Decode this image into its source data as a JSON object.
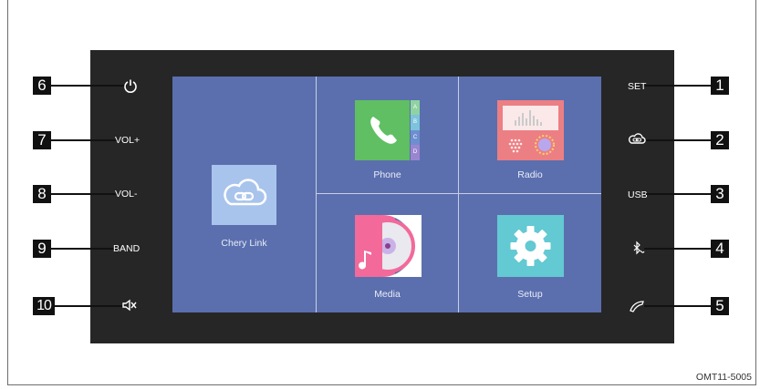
{
  "screen": {
    "tiles": {
      "link": {
        "label": "Chery Link",
        "icon": "chery-link-cloud-icon",
        "color": "#a9c4ec"
      },
      "phone": {
        "label": "Phone",
        "icon": "phone-handset-icon",
        "color": "#5fbf62",
        "index_tabs": [
          "A",
          "B",
          "C",
          "D"
        ]
      },
      "radio": {
        "label": "Radio",
        "icon": "radio-icon",
        "color": "#ec7f83"
      },
      "media": {
        "label": "Media",
        "icon": "media-disc-icon",
        "color": "#f2699a"
      },
      "setup": {
        "label": "Setup",
        "icon": "gear-icon",
        "color": "#63c9d3"
      }
    }
  },
  "left_buttons": [
    {
      "number": "6",
      "label": "",
      "icon": "power-icon"
    },
    {
      "number": "7",
      "label": "VOL+",
      "icon": ""
    },
    {
      "number": "8",
      "label": "VOL-",
      "icon": ""
    },
    {
      "number": "9",
      "label": "BAND",
      "icon": ""
    },
    {
      "number": "10",
      "label": "",
      "icon": "mute-icon"
    }
  ],
  "right_buttons": [
    {
      "number": "1",
      "label": "SET",
      "icon": ""
    },
    {
      "number": "2",
      "label": "",
      "icon": "chery-link-icon"
    },
    {
      "number": "3",
      "label": "USB",
      "icon": ""
    },
    {
      "number": "4",
      "label": "",
      "icon": "bluetooth-phone-icon"
    },
    {
      "number": "5",
      "label": "",
      "icon": "hang-up-icon"
    }
  ],
  "caption": "OMT11-5005"
}
